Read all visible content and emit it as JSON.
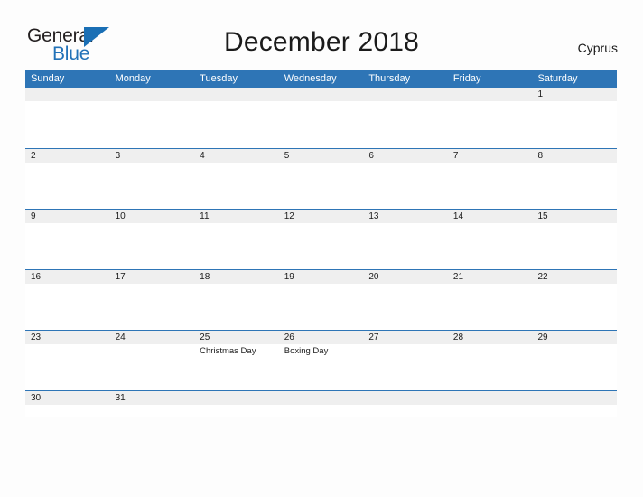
{
  "brand": {
    "name_part1": "General",
    "name_part2": "Blue",
    "triangle_icon": "triangle-icon",
    "colors": {
      "general": "#231f20",
      "blue": "#2272b8",
      "triangle": "#1a6fb5"
    }
  },
  "header": {
    "title": "December 2018",
    "locale": "Cyprus"
  },
  "theme": {
    "header_blue": "#2e75b6",
    "band_gray": "#efefef",
    "page_background": "#fdfdfd",
    "text": "#1b1b1b"
  },
  "calendar": {
    "weekdays": [
      "Sunday",
      "Monday",
      "Tuesday",
      "Wednesday",
      "Thursday",
      "Friday",
      "Saturday"
    ],
    "weeks": [
      {
        "days": [
          {
            "number": "",
            "event": ""
          },
          {
            "number": "",
            "event": ""
          },
          {
            "number": "",
            "event": ""
          },
          {
            "number": "",
            "event": ""
          },
          {
            "number": "",
            "event": ""
          },
          {
            "number": "",
            "event": ""
          },
          {
            "number": "1",
            "event": ""
          }
        ]
      },
      {
        "days": [
          {
            "number": "2",
            "event": ""
          },
          {
            "number": "3",
            "event": ""
          },
          {
            "number": "4",
            "event": ""
          },
          {
            "number": "5",
            "event": ""
          },
          {
            "number": "6",
            "event": ""
          },
          {
            "number": "7",
            "event": ""
          },
          {
            "number": "8",
            "event": ""
          }
        ]
      },
      {
        "days": [
          {
            "number": "9",
            "event": ""
          },
          {
            "number": "10",
            "event": ""
          },
          {
            "number": "11",
            "event": ""
          },
          {
            "number": "12",
            "event": ""
          },
          {
            "number": "13",
            "event": ""
          },
          {
            "number": "14",
            "event": ""
          },
          {
            "number": "15",
            "event": ""
          }
        ]
      },
      {
        "days": [
          {
            "number": "16",
            "event": ""
          },
          {
            "number": "17",
            "event": ""
          },
          {
            "number": "18",
            "event": ""
          },
          {
            "number": "19",
            "event": ""
          },
          {
            "number": "20",
            "event": ""
          },
          {
            "number": "21",
            "event": ""
          },
          {
            "number": "22",
            "event": ""
          }
        ]
      },
      {
        "days": [
          {
            "number": "23",
            "event": ""
          },
          {
            "number": "24",
            "event": ""
          },
          {
            "number": "25",
            "event": "Christmas Day"
          },
          {
            "number": "26",
            "event": "Boxing Day"
          },
          {
            "number": "27",
            "event": ""
          },
          {
            "number": "28",
            "event": ""
          },
          {
            "number": "29",
            "event": ""
          }
        ]
      },
      {
        "days": [
          {
            "number": "30",
            "event": ""
          },
          {
            "number": "31",
            "event": ""
          },
          {
            "number": "",
            "event": ""
          },
          {
            "number": "",
            "event": ""
          },
          {
            "number": "",
            "event": ""
          },
          {
            "number": "",
            "event": ""
          },
          {
            "number": "",
            "event": ""
          }
        ]
      }
    ]
  }
}
